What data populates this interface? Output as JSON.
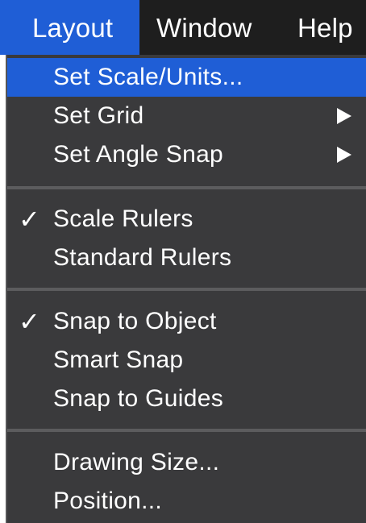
{
  "menubar": {
    "items": [
      {
        "label": "Layout",
        "active": true
      },
      {
        "label": "Window",
        "active": false
      },
      {
        "label": "Help",
        "active": false
      }
    ]
  },
  "menu": {
    "items": [
      {
        "label": "Set Scale/Units...",
        "checked": false,
        "submenu": false,
        "highlighted": true
      },
      {
        "label": "Set Grid",
        "checked": false,
        "submenu": true,
        "highlighted": false
      },
      {
        "label": "Set Angle Snap",
        "checked": false,
        "submenu": true,
        "highlighted": false
      },
      {
        "label": "Scale Rulers",
        "checked": true,
        "submenu": false,
        "highlighted": false
      },
      {
        "label": "Standard Rulers",
        "checked": false,
        "submenu": false,
        "highlighted": false
      },
      {
        "label": "Snap to Object",
        "checked": true,
        "submenu": false,
        "highlighted": false
      },
      {
        "label": "Smart Snap",
        "checked": false,
        "submenu": false,
        "highlighted": false
      },
      {
        "label": "Snap to Guides",
        "checked": false,
        "submenu": false,
        "highlighted": false
      },
      {
        "label": "Drawing Size...",
        "checked": false,
        "submenu": false,
        "highlighted": false
      },
      {
        "label": "Position...",
        "checked": false,
        "submenu": false,
        "highlighted": false
      }
    ],
    "checkmark_glyph": "✓"
  },
  "colors": {
    "menubar_bg": "#1e1e1e",
    "menu_bg": "#3a3a3c",
    "highlight": "#1f5ed6",
    "separator": "#5c5c5e",
    "text": "#ffffff"
  }
}
